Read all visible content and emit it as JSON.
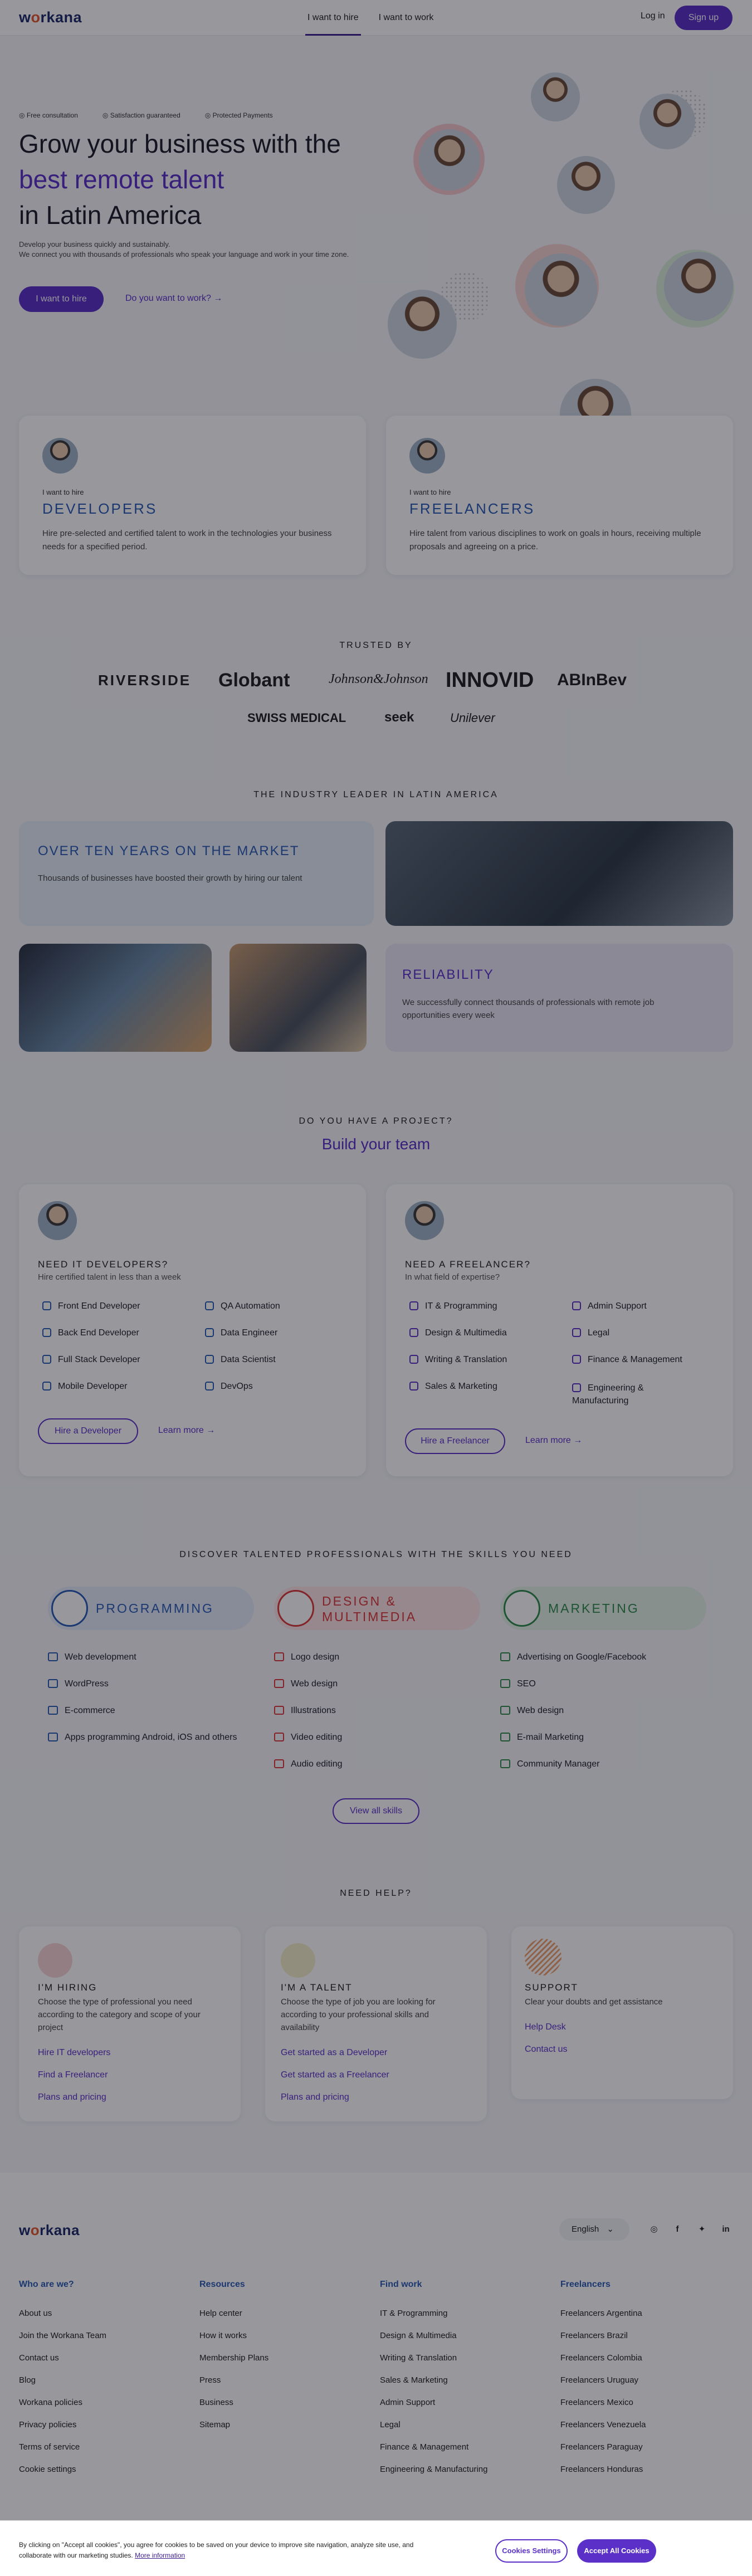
{
  "header": {
    "logo_a": "w",
    "logo_o": "o",
    "logo_b": "rkana",
    "nav": [
      "I want to hire",
      "I want to work"
    ],
    "login": "Log in",
    "signup": "Sign up"
  },
  "hero": {
    "badges": [
      "Free consultation",
      "Satisfaction guaranteed",
      "Protected Payments"
    ],
    "title_line1": "Grow your business with the",
    "title_line2": "best remote talent",
    "title_line3": "in Latin America",
    "sub1": "Develop your business quickly and sustainably.",
    "sub2": "We connect you with thousands of professionals who speak your language and work in your time zone.",
    "hire_button": "I want to hire",
    "work_link": "Do you want to work?"
  },
  "cards": [
    {
      "label": "I want to hire",
      "title": "DEVELOPERS",
      "text": "Hire pre-selected and certified talent to work in the technologies your business needs for a specified period."
    },
    {
      "label": "I want to hire",
      "title": "FREELANCERS",
      "text": "Hire talent from various disciplines to work on goals in hours, receiving multiple proposals and agreeing on a price."
    }
  ],
  "trusted": {
    "caption": "TRUSTED BY",
    "brands": [
      "RIVERSIDE",
      "Globant",
      "Johnson&Johnson",
      "INNOVID",
      "ABInBev",
      "SWISS MEDICAL",
      "seek",
      "Unilever"
    ]
  },
  "industry": {
    "caption": "THE INDUSTRY LEADER IN LATIN AMERICA",
    "box1_title": "OVER TEN YEARS ON THE MARKET",
    "box1_text": "Thousands of businesses have boosted their growth by hiring our talent",
    "box2_title": "RELIABILITY",
    "box2_text": "We successfully connect thousands of professionals with remote job opportunities every week"
  },
  "team": {
    "caption": "DO YOU HAVE A PROJECT?",
    "title": "Build your team",
    "dev": {
      "title": "NEED IT DEVELOPERS?",
      "sub": "Hire certified talent in less than a week",
      "skills": [
        "Front End Developer",
        "QA Automation",
        "Back End Developer",
        "Data Engineer",
        "Full Stack Developer",
        "Data Scientist",
        "Mobile Developer",
        "DevOps"
      ],
      "button": "Hire a Developer",
      "learn": "Learn more"
    },
    "free": {
      "title": "NEED A FREELANCER?",
      "sub": "In what field of expertise?",
      "skills": [
        "IT & Programming",
        "Admin Support",
        "Design & Multimedia",
        "Legal",
        "Writing & Translation",
        "Finance & Management",
        "Sales & Marketing",
        "Engineering & Manufacturing"
      ],
      "button": "Hire a Freelancer",
      "learn": "Learn more"
    }
  },
  "discover": {
    "caption": "DISCOVER TALENTED PROFESSIONALS WITH THE SKILLS YOU NEED",
    "cats": [
      {
        "title": "PROGRAMMING",
        "color": "#2a5ab5",
        "bg": "#e3ebf8",
        "items": [
          "Web development",
          "WordPress",
          "E-commerce",
          "Apps programming Android, iOS and others"
        ]
      },
      {
        "title": "DESIGN & MULTIMEDIA",
        "color": "#d9383a",
        "bg": "#fbe4e4",
        "items": [
          "Logo design",
          "Web design",
          "Illustrations",
          "Video editing",
          "Audio editing"
        ]
      },
      {
        "title": "MARKETING",
        "color": "#2e8a4a",
        "bg": "#e2f2e6",
        "items": [
          "Advertising on Google/Facebook",
          "SEO",
          "Web design",
          "E-mail Marketing",
          "Community Manager"
        ]
      }
    ],
    "view_all": "View all skills"
  },
  "help": {
    "caption": "NEED HELP?",
    "cols": [
      {
        "title": "I'M HIRING",
        "text": "Choose the type of professional you need according to the category and scope of your project",
        "links": [
          "Hire IT developers",
          "Find a Freelancer",
          "Plans and pricing"
        ]
      },
      {
        "title": "I'M A TALENT",
        "text": "Choose the type of job you are looking for according to your professional skills and availability",
        "links": [
          "Get started as a Developer",
          "Get started as a Freelancer",
          "Plans and pricing"
        ]
      },
      {
        "title": "SUPPORT",
        "text": "Clear your doubts and get assistance",
        "links": [
          "Help Desk",
          "Contact us"
        ]
      }
    ]
  },
  "footer": {
    "language": "English",
    "social": [
      "instagram",
      "facebook",
      "twitter",
      "linkedin"
    ],
    "cols": [
      {
        "title": "Who are we?",
        "links": [
          "About us",
          "Join the Workana Team",
          "Contact us",
          "Blog",
          "Workana policies",
          "Privacy policies",
          "Terms of service",
          "Cookie settings"
        ]
      },
      {
        "title": "Resources",
        "links": [
          "Help center",
          "How it works",
          "Membership Plans",
          "Press",
          "Business",
          "Sitemap"
        ]
      },
      {
        "title": "Find work",
        "links": [
          "IT & Programming",
          "Design & Multimedia",
          "Writing & Translation",
          "Sales & Marketing",
          "Admin Support",
          "Legal",
          "Finance & Management",
          "Engineering & Manufacturing"
        ]
      },
      {
        "title": "Freelancers",
        "links": [
          "Freelancers Argentina",
          "Freelancers Brazil",
          "Freelancers Colombia",
          "Freelancers Uruguay",
          "Freelancers Mexico",
          "Freelancers Venezuela",
          "Freelancers Paraguay",
          "Freelancers Honduras"
        ]
      }
    ]
  },
  "cookie": {
    "text": "By clicking on \"Accept all cookies\", you agree for cookies to be saved on your device to improve site navigation, analyze site use, and collaborate with our marketing studies.",
    "more": "More information",
    "settings": "Cookies Settings",
    "accept": "Accept All Cookies"
  }
}
